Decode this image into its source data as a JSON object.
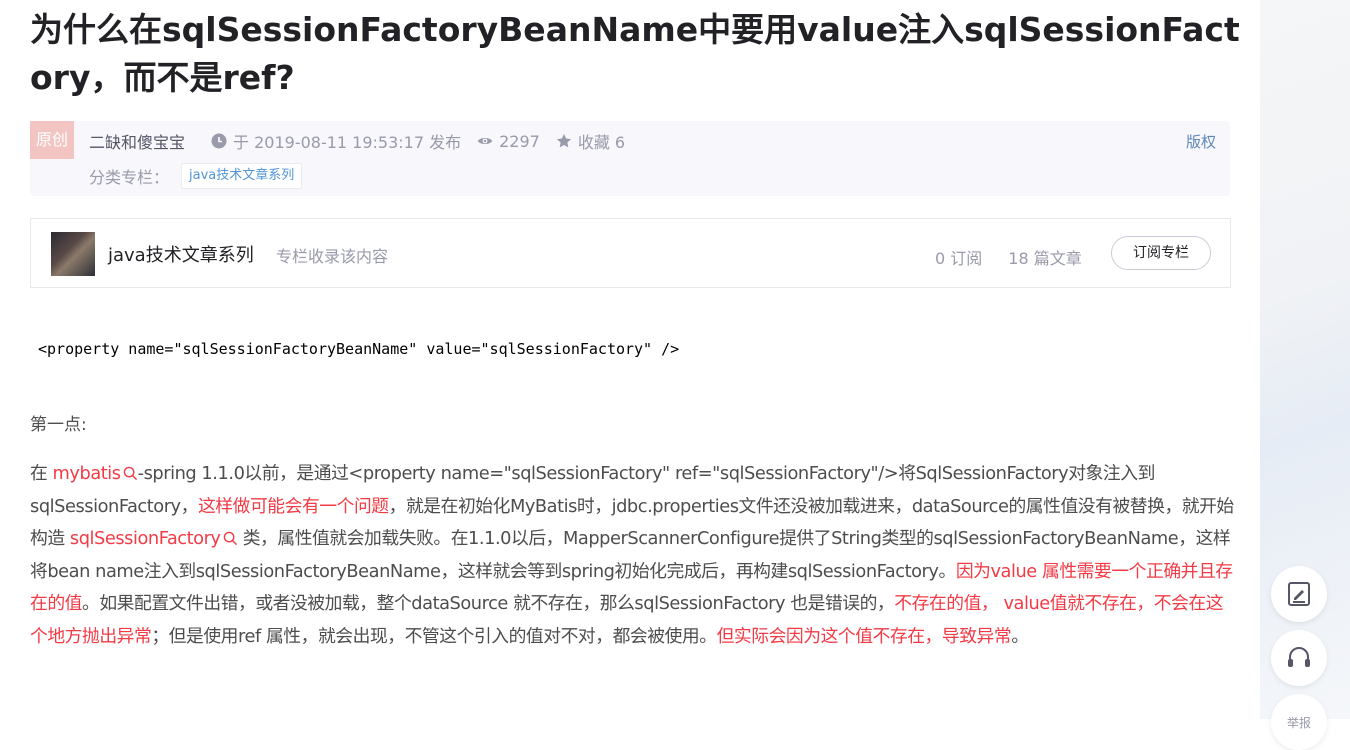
{
  "title": "为什么在sqlSessionFactoryBeanName中要用value注入sqlSessionFactory，而不是ref?",
  "meta": {
    "badge": "原创",
    "author": "二缺和傻宝宝",
    "publish": "于 2019-08-11 19:53:17 发布",
    "views": "2297",
    "favorites": "收藏 6",
    "copyright": "版权",
    "category_label": "分类专栏：",
    "category_tag": "java技术文章系列"
  },
  "column": {
    "name": "java技术文章系列",
    "desc": "专栏收录该内容",
    "subscribers": "0 订阅",
    "articles": "18 篇文章",
    "subscribe_button": "订阅专栏"
  },
  "content": {
    "code": "<property name=\"sqlSessionFactoryBeanName\" value=\"sqlSessionFactory\" />",
    "point": "第一点:",
    "p1": "在 ",
    "kw1": "mybatis",
    "p2": "-spring 1.1.0以前，是通过<property name=\"sqlSessionFactory\" ref=\"sqlSessionFactory\"/>将SqlSessionFactory对象注入到sqlSessionFactory，",
    "r1": "这样做可能会有一个问题",
    "p3": "，就是在初始化MyBatis时，jdbc.properties文件还没被加载进来，dataSource的属性值没有被替换，就开始构造 ",
    "kw2": "sqlSessionFactory",
    "p4": " 类，属性值就会加载失败。在1.1.0以后，MapperScannerConfigure提供了String类型的sqlSessionFactoryBeanName，这样将bean name注入到sqlSessionFactoryBeanName，这样就会等到spring初始化完成后，再构建sqlSessionFactory。",
    "r2": "因为value 属性需要一个正确并且存在的值",
    "p5": "。如果配置文件出错，或者没被加载，整个dataSource 就不存在，那么sqlSessionFactory 也是错误的，",
    "r3": "不存在的值， value值就不存在，不会在这个地方抛出异常",
    "p6": "；但是使用ref 属性，就会出现，不管这个引入的值对不对，都会被使用。",
    "r4": "但实际会因为这个值不存在，导致异常",
    "p7": "。"
  },
  "sidebar": {
    "report_label": "举报"
  }
}
